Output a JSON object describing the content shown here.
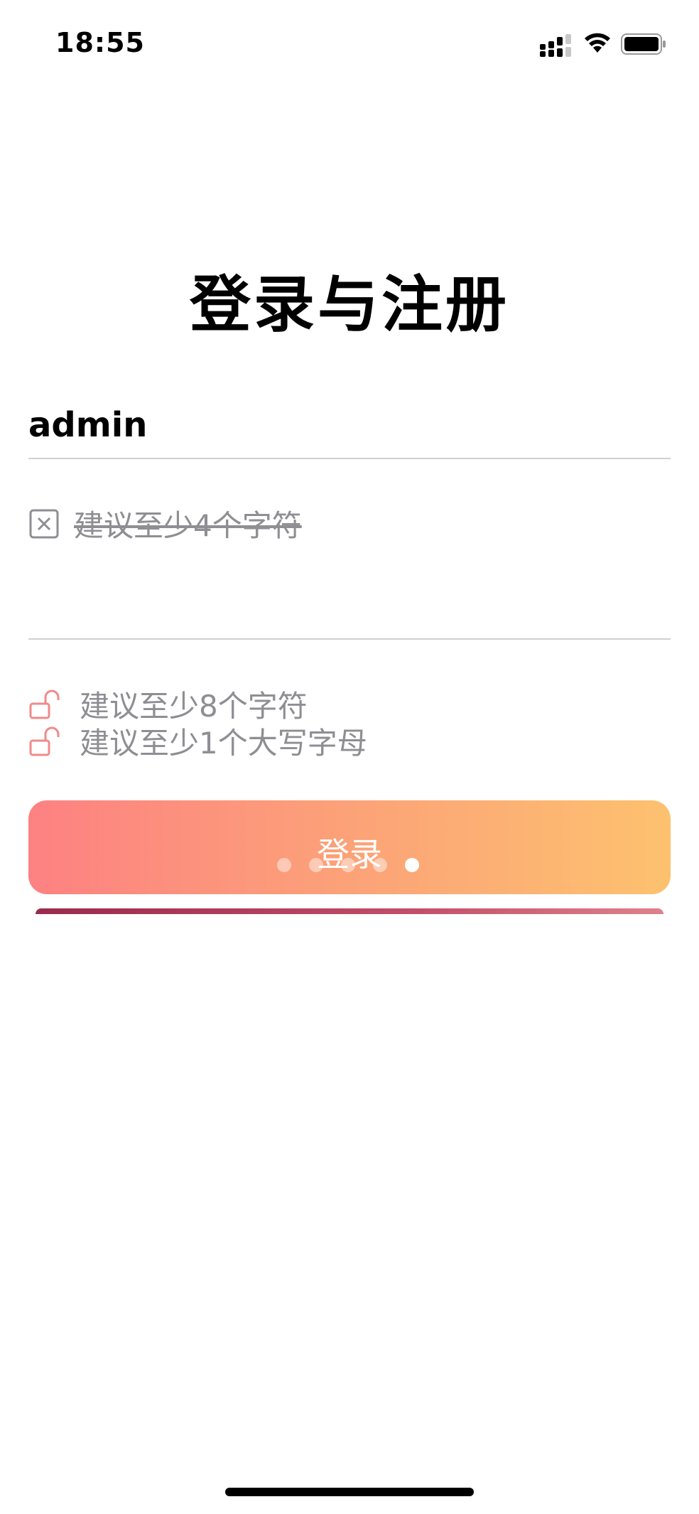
{
  "status_bar": {
    "time": "18:55",
    "icons": [
      "signal-icon",
      "wifi-icon",
      "battery-icon"
    ]
  },
  "page": {
    "title": "登录与注册"
  },
  "username": {
    "value": "admin",
    "rule": {
      "icon": "close-square-icon",
      "text": "建议至少4个字符",
      "satisfied": true
    }
  },
  "password": {
    "value": "",
    "rules": [
      {
        "icon": "unlock-icon",
        "text": "建议至少8个字符",
        "satisfied": false
      },
      {
        "icon": "unlock-icon",
        "text": "建议至少1个大写字母",
        "satisfied": false
      }
    ]
  },
  "login_button": {
    "label": "登录",
    "gradient": [
      "#fd8182",
      "#fca278",
      "#fdc16f"
    ]
  },
  "pager": {
    "count": 5,
    "active_index": 4
  },
  "colors": {
    "accent_icon": "#f08a8a",
    "muted_text": "#8e8e93",
    "divider": "#d0d0d0"
  }
}
